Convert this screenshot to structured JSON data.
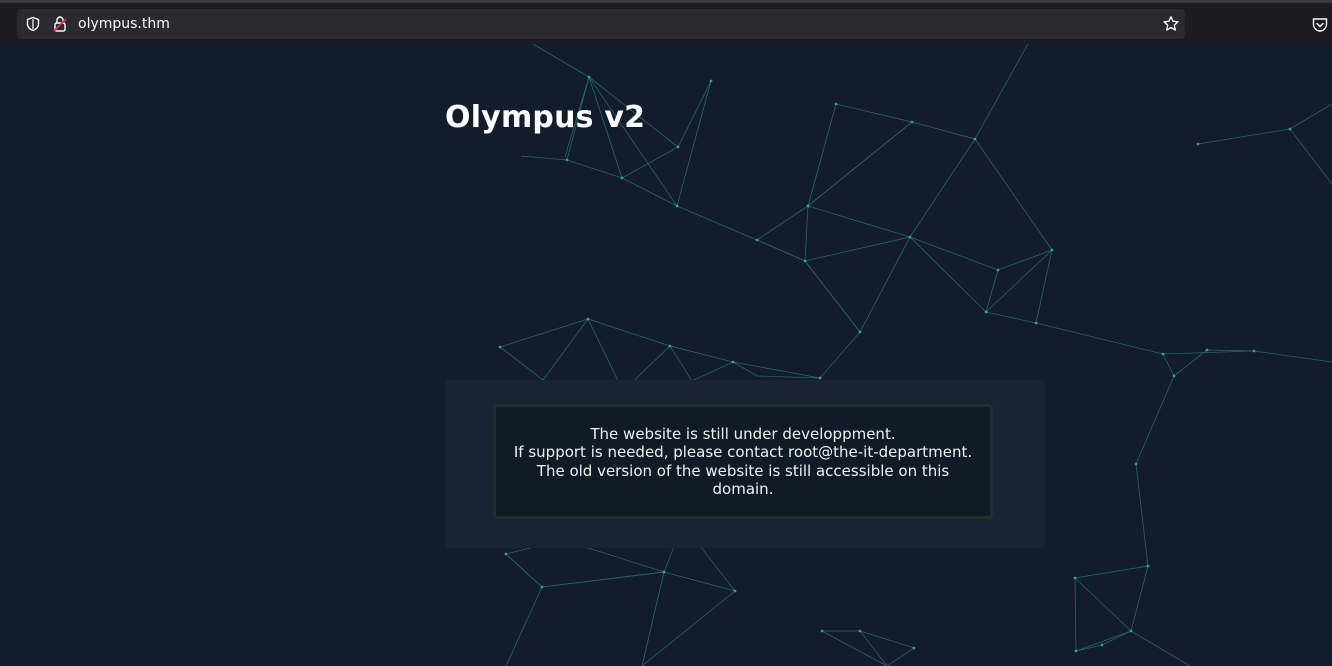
{
  "browser": {
    "url": "olympus.thm",
    "icons": {
      "tracking": "shield-icon",
      "security": "lock-icon",
      "bookmark": "star-icon",
      "pocket": "pocket-icon"
    }
  },
  "page": {
    "title": "Olympus v2",
    "message_lines": [
      "The website is still under developpment.",
      "If support is needed, please contact root@the-it-department.",
      "The old version of the website is still accessible on this",
      "domain."
    ]
  },
  "colors": {
    "background": "#131c2b",
    "network_lines": "#2a8f8a",
    "panel": "#1a2332",
    "message_box": "#111a27"
  }
}
